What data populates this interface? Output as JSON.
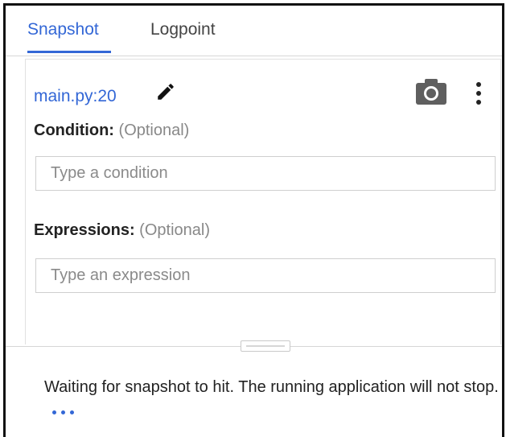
{
  "tabs": [
    {
      "label": "Snapshot",
      "active": true
    },
    {
      "label": "Logpoint",
      "active": false
    }
  ],
  "breakpoint": {
    "location": "main.py:20"
  },
  "icons": {
    "edit": "edit-pencil-icon",
    "camera": "camera-icon",
    "more": "more-vert-icon"
  },
  "condition": {
    "label": "Condition:",
    "optional": "(Optional)",
    "placeholder": "Type a condition",
    "value": ""
  },
  "expressions": {
    "label": "Expressions:",
    "optional": "(Optional)",
    "placeholder": "Type an expression",
    "value": ""
  },
  "status": {
    "message": "Waiting for snapshot to hit. The running application will not stop."
  },
  "colors": {
    "accent": "#3367d6",
    "text": "#222222",
    "muted": "#888888"
  }
}
